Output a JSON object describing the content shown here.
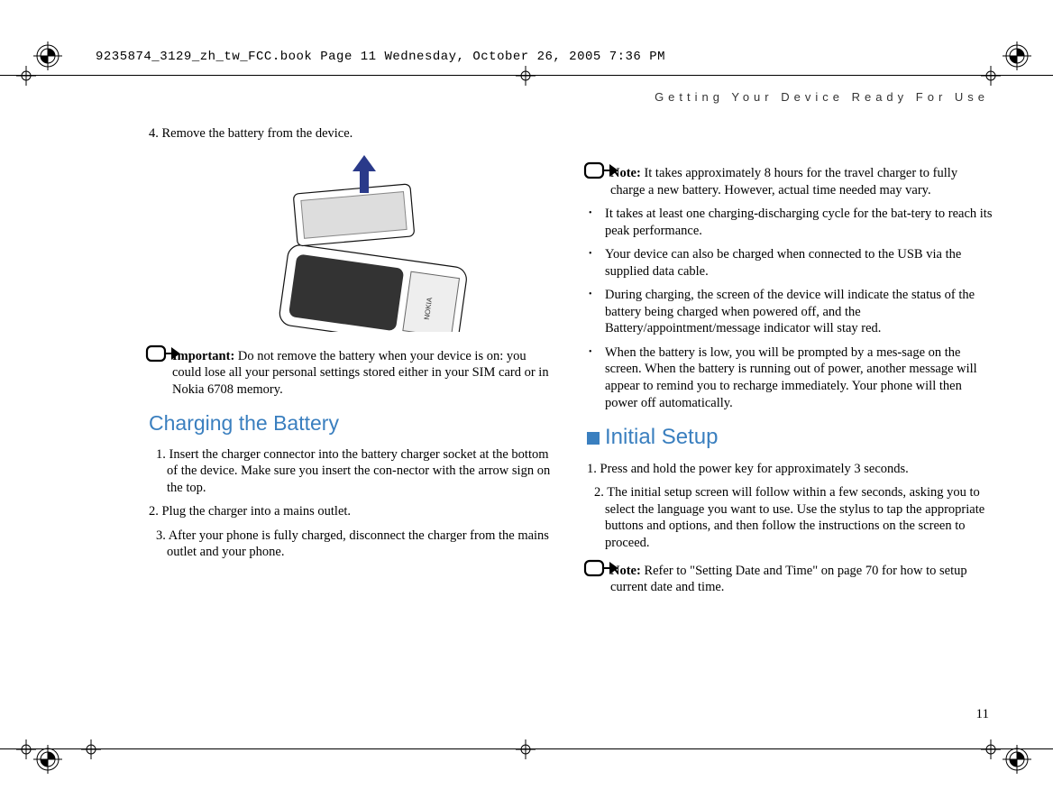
{
  "header": "9235874_3129_zh_tw_FCC.book  Page 11  Wednesday, October 26, 2005  7:36 PM",
  "chapter": "Getting Your Device Ready For Use",
  "left": {
    "step4": "4. Remove the battery from the device.",
    "important_label": "Important:",
    "important_body": " Do not remove the battery when your device is on: you could lose all your personal settings stored either in your SIM card or in Nokia 6708 memory.",
    "h_charging": "Charging the Battery",
    "c1": "1. Insert the charger connector into the battery charger socket at the bottom of the device. Make sure you insert the con-nector with the arrow sign on the top.",
    "c2": "2. Plug the charger into a mains outlet.",
    "c3": "3. After your phone is fully charged, disconnect the charger from the mains outlet and your phone."
  },
  "right": {
    "note1_label": "Note:",
    "note1_body": " It takes approximately 8 hours for the travel charger to fully charge a new battery. However, actual time needed may vary.",
    "b1": "It takes at least one charging-discharging cycle for the bat-tery to reach its peak performance.",
    "b2": "Your device can also be charged when connected to the USB via the supplied data cable.",
    "b3": "During charging, the screen of the device will indicate the status of the battery being charged when powered off, and the Battery/appointment/message indicator will stay red.",
    "b4": "When the battery is low, you will be prompted by a mes-sage on the screen. When the battery is running out of power, another message will appear to remind you to recharge immediately. Your phone will then power off automatically.",
    "h_initial": "Initial Setup",
    "i1": "1. Press and hold the power key for approximately 3 seconds.",
    "i2": "2. The initial setup screen will follow within a few seconds, asking you to select the language you want to use. Use the stylus to tap the appropriate buttons and options, and then follow the instructions on the screen to proceed.",
    "note2_label": "Note:",
    "note2_body": " Refer to \"Setting Date and Time\" on page 70 for how to setup current date and time."
  },
  "page_number": "11"
}
